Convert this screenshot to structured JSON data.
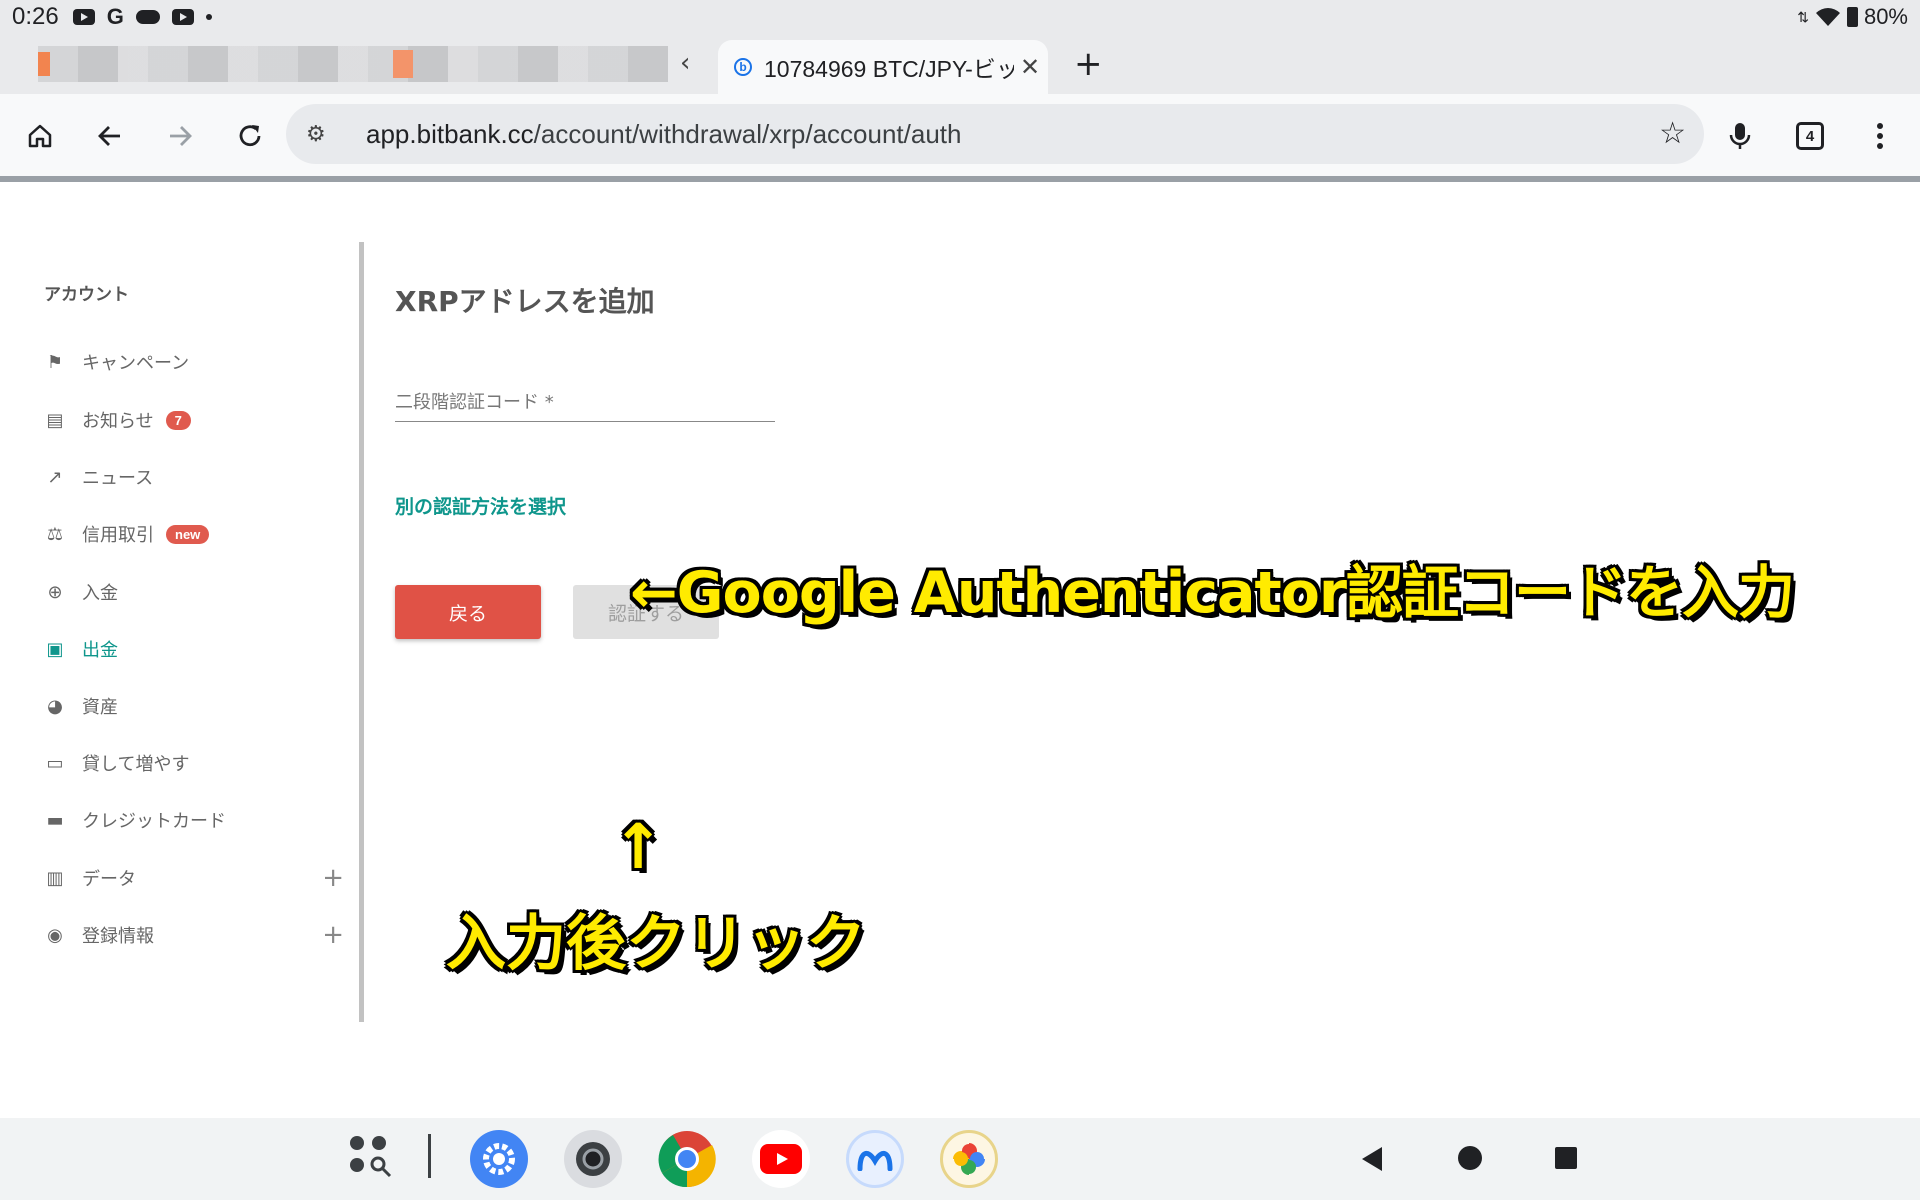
{
  "status_bar": {
    "time": "0:26",
    "battery": "80%"
  },
  "tabs": {
    "active_title": "10784969 BTC/JPY-ビッ",
    "favicon_letter": "b",
    "tab_count": "4"
  },
  "toolbar": {
    "url_host": "app.bitbank.cc",
    "url_path": "/account/withdrawal/xrp/account/auth"
  },
  "sidebar": {
    "section_title": "アカウント",
    "items": [
      {
        "label": "キャンペーン",
        "icon": "flag-icon"
      },
      {
        "label": "お知らせ",
        "icon": "message-icon",
        "badge": "7"
      },
      {
        "label": "ニュース",
        "icon": "news-icon"
      },
      {
        "label": "信用取引",
        "icon": "scale-icon",
        "badge": "new"
      },
      {
        "label": "入金",
        "icon": "plus-circle-icon"
      },
      {
        "label": "出金",
        "icon": "wallet-icon"
      },
      {
        "label": "資産",
        "icon": "pie-chart-icon"
      },
      {
        "label": "貸して増やす",
        "icon": "cash-icon"
      },
      {
        "label": "クレジットカード",
        "icon": "credit-card-icon"
      },
      {
        "label": "データ",
        "icon": "clipboard-icon"
      },
      {
        "label": "登録情報",
        "icon": "account-circle-icon"
      }
    ]
  },
  "main": {
    "title": "XRPアドレスを追加",
    "code_placeholder": "二段階認証コード *",
    "alt_method_link": "別の認証方法を選択",
    "back_button": "戻る",
    "auth_button": "認証する"
  },
  "annotations": {
    "code_hint": "←Google Authenticator認証コードを入力",
    "arrow": "↑",
    "click_hint": "入力後クリック"
  },
  "colors": {
    "accent": "#0f968c",
    "back_button": "#e05246",
    "badge": "#e05a4e",
    "annotation": "#ffeb00"
  }
}
